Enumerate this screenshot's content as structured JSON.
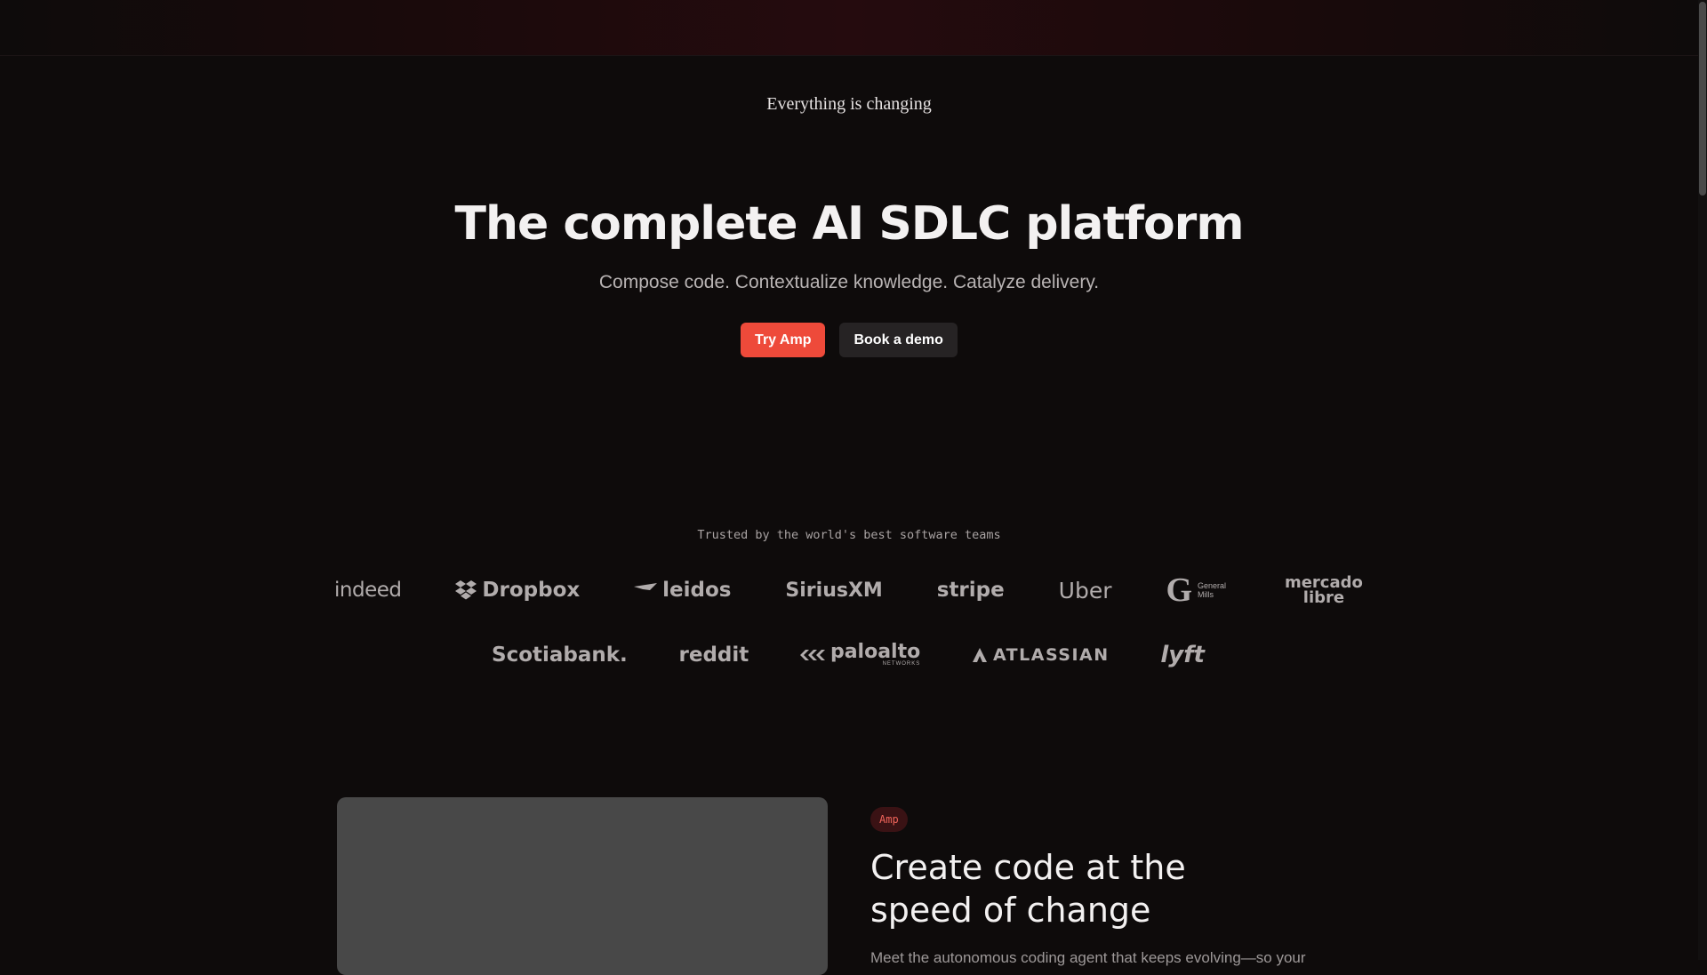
{
  "hero": {
    "eyebrow": "Everything is changing",
    "title": "The complete AI SDLC platform",
    "subtitle": "Compose code. Contextualize knowledge. Catalyze delivery.",
    "primary_button": "Try Amp",
    "secondary_button": "Book a demo"
  },
  "trusted": {
    "heading": "Trusted by the world's best software teams",
    "logos_row1": [
      {
        "name": "indeed",
        "text": "indeed"
      },
      {
        "name": "dropbox",
        "text": "Dropbox"
      },
      {
        "name": "leidos",
        "text": "leidos"
      },
      {
        "name": "siriusxm",
        "text": "SiriusXM"
      },
      {
        "name": "stripe",
        "text": "stripe"
      },
      {
        "name": "uber",
        "text": "Uber"
      },
      {
        "name": "general-mills",
        "text": "General Mills"
      },
      {
        "name": "mercado-libre",
        "text": "mercado libre"
      }
    ],
    "logos_row2": [
      {
        "name": "scotiabank",
        "text": "Scotiabank."
      },
      {
        "name": "reddit",
        "text": "reddit"
      },
      {
        "name": "paloalto",
        "text": "paloalto",
        "sub": "NETWORKS"
      },
      {
        "name": "atlassian",
        "text": "ATLASSIAN"
      },
      {
        "name": "lyft",
        "text": "lyft"
      }
    ]
  },
  "feature": {
    "tag": "Amp",
    "title": "Create code at the speed of change",
    "body": "Meet the autonomous coding agent that keeps evolving—so your"
  },
  "colors": {
    "background": "#0e0b0b",
    "accent": "#ee4a3a",
    "secondary_button": "#262324",
    "tag_text": "#f0645a"
  }
}
